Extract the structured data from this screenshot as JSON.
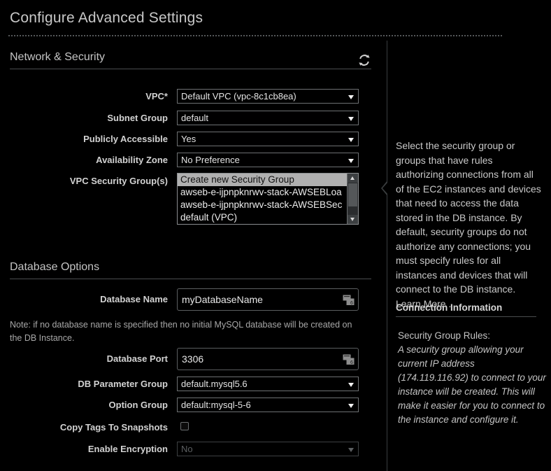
{
  "page": {
    "title": "Configure Advanced Settings"
  },
  "network_section": {
    "heading": "Network & Security",
    "refresh_icon": "refresh-icon",
    "fields": {
      "vpc": {
        "label": "VPC*",
        "value": "Default VPC (vpc-8c1cb8ea)"
      },
      "subnet_group": {
        "label": "Subnet Group",
        "value": "default"
      },
      "publicly_accessible": {
        "label": "Publicly Accessible",
        "value": "Yes"
      },
      "availability_zone": {
        "label": "Availability Zone",
        "value": "No Preference"
      },
      "vpc_security_groups": {
        "label": "VPC Security Group(s)",
        "options": [
          "Create new Security Group",
          "awseb-e-ijpnpknrwv-stack-AWSEBLoa",
          "awseb-e-ijpnpknrwv-stack-AWSEBSec",
          "default (VPC)"
        ],
        "selected_index": 0
      }
    }
  },
  "database_section": {
    "heading": "Database Options",
    "note": "Note: if no database name is specified then no initial MySQL database will be created on the DB Instance.",
    "fields": {
      "database_name": {
        "label": "Database Name",
        "value": "myDatabaseName"
      },
      "database_port": {
        "label": "Database Port",
        "value": "3306"
      },
      "db_parameter_group": {
        "label": "DB Parameter Group",
        "value": "default.mysql5.6"
      },
      "option_group": {
        "label": "Option Group",
        "value": "default:mysql-5-6"
      },
      "copy_tags_to_snapshots": {
        "label": "Copy Tags To Snapshots",
        "checked": false
      },
      "enable_encryption": {
        "label": "Enable Encryption",
        "value": "No",
        "disabled": true
      }
    }
  },
  "help_panel": {
    "body": "Select the security group or groups that have rules authorizing connections from all of the EC2 instances and devices that need to access the data stored in the DB instance. By default, security groups do not authorize any connections; you must specify rules for all instances and devices that will connect to the DB instance. ",
    "learn_more": "Learn More .",
    "connection_heading": "Connection Information",
    "rules_label": "Security Group Rules:",
    "rules_detail": "A security group allowing your current IP address (174.119.116.92) to connect to your instance will be created. This will make it easier for you to connect to the instance and configure it."
  },
  "colors": {
    "background": "#000000",
    "text": "#cfcfcf",
    "border": "#6e7173",
    "selection": "#b0b0b0"
  }
}
